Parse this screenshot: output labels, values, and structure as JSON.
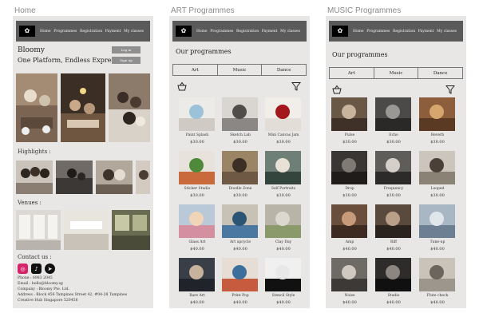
{
  "frames": {
    "home": "Home",
    "art": "ART Programmes",
    "music": "MUSIC Programmes"
  },
  "nav": {
    "logo": "✿",
    "items": [
      "Home",
      "Programmes",
      "Registration",
      "Payment",
      "My classes"
    ]
  },
  "home": {
    "brand": "Bloomy",
    "tagline": "One Platform, Endless Expressions",
    "btn1": "Log in",
    "btn2": "Sign up",
    "highlights_title": "Highlights :",
    "venues_title": "Venues :",
    "contact_title": "Contact us :",
    "phone": "Phone : 6983 2045",
    "email": "Email : hello@bloomy.sg",
    "company": "Company : Bloomy Pte. Ltd.",
    "address": "Address : Block 456 Tampines Street 42, #04-28 Tampines",
    "address2": "Creative Hub Singapore 520456",
    "social_icons": [
      "instagram-icon",
      "tiktok-icon",
      "telegram-icon"
    ]
  },
  "programmes": {
    "heading": "Our programmes",
    "tabs": [
      "Art",
      "Music",
      "Dance"
    ]
  },
  "art_cards": [
    {
      "name": "Paint Splash",
      "price": "$30.00"
    },
    {
      "name": "Sketch Lab",
      "price": "$30.00"
    },
    {
      "name": "Mini Canvas Jam",
      "price": "$30.00"
    },
    {
      "name": "Sticker Studio",
      "price": "$30.00"
    },
    {
      "name": "Doodle Zone",
      "price": "$30.00"
    },
    {
      "name": "Self Portraits",
      "price": "$30.00"
    },
    {
      "name": "Glass Art",
      "price": "$40.00"
    },
    {
      "name": "Art upcycle",
      "price": "$40.00"
    },
    {
      "name": "Clay Day",
      "price": "$40.00"
    },
    {
      "name": "Bare Art",
      "price": "$40.00"
    },
    {
      "name": "Print Pop",
      "price": "$40.00"
    },
    {
      "name": "Stencil Style",
      "price": "$40.00"
    }
  ],
  "music_cards": [
    {
      "name": "Pulse",
      "price": "$30.00"
    },
    {
      "name": "Echo",
      "price": "$30.00"
    },
    {
      "name": "Reverb",
      "price": "$30.00"
    },
    {
      "name": "Drop",
      "price": "$30.00"
    },
    {
      "name": "Frequency",
      "price": "$30.00"
    },
    {
      "name": "Looped",
      "price": "$30.00"
    },
    {
      "name": "Amp",
      "price": "$40.00"
    },
    {
      "name": "Riff",
      "price": "$40.00"
    },
    {
      "name": "Tune-up",
      "price": "$40.00"
    },
    {
      "name": "Noize",
      "price": "$40.00"
    },
    {
      "name": "Studio",
      "price": "$40.00"
    },
    {
      "name": "Flute check",
      "price": "$40.00"
    }
  ]
}
